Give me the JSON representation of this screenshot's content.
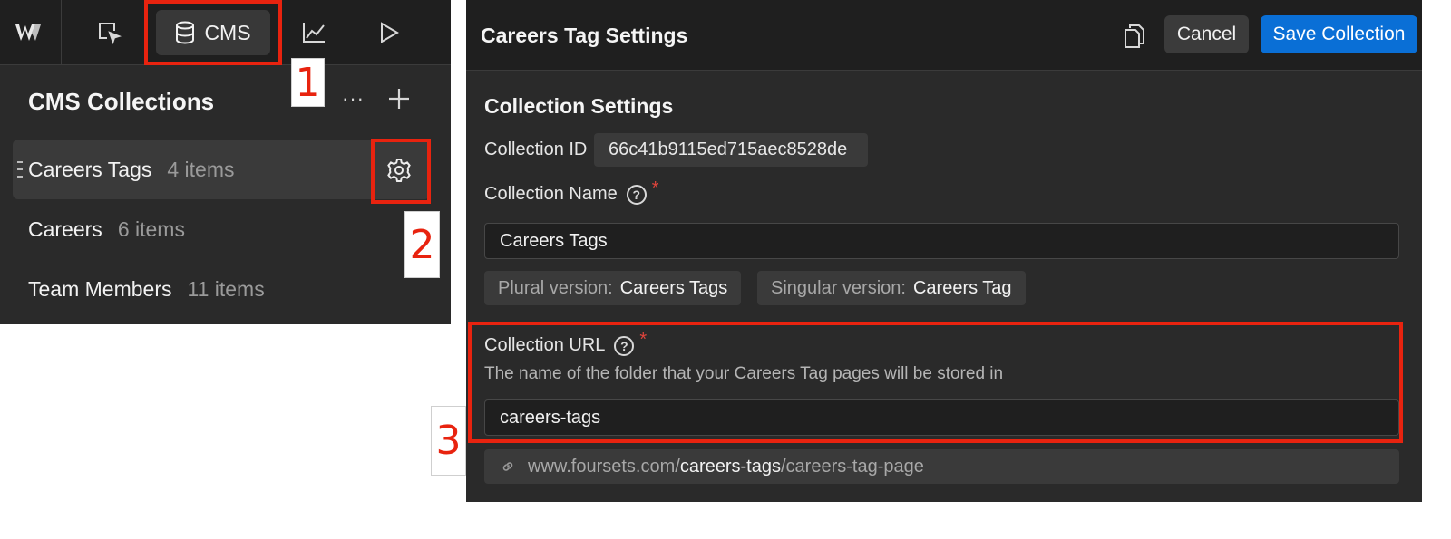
{
  "top_nav": {
    "logo_icon": "webflow-logo-icon",
    "tabs": [
      {
        "icon": "cursor-select-icon",
        "label": ""
      },
      {
        "icon": "database-icon",
        "label": "CMS"
      },
      {
        "icon": "analytics-chart-icon",
        "label": ""
      },
      {
        "icon": "play-icon",
        "label": ""
      }
    ]
  },
  "cms_panel": {
    "title": "CMS Collections",
    "more_label": "···",
    "collections": [
      {
        "name": "Careers Tags",
        "count": "4 items",
        "active": true
      },
      {
        "name": "Careers",
        "count": "6 items",
        "active": false
      },
      {
        "name": "Team Members",
        "count": "11 items",
        "active": false
      }
    ]
  },
  "settings": {
    "title": "Careers Tag Settings",
    "cancel_label": "Cancel",
    "save_label": "Save Collection",
    "section_title": "Collection Settings",
    "collection_id_label": "Collection ID",
    "collection_id": "66c41b9115ed715aec8528de",
    "collection_name_label": "Collection Name",
    "collection_name": "Careers Tags",
    "plural_label": "Plural version:",
    "plural_value": "Careers Tags",
    "singular_label": "Singular version:",
    "singular_value": "Careers Tag",
    "collection_url_label": "Collection URL",
    "collection_url_desc": "The name of the folder that your Careers Tag pages will be stored in",
    "collection_url": "careers-tags",
    "url_preview": {
      "domain": "www.foursets.com/",
      "slug": "careers-tags",
      "page": "/careers-tag-page"
    },
    "required_mark": "*",
    "help_mark": "?"
  },
  "annotations": {
    "step1": "1",
    "step2": "2",
    "step3": "3"
  },
  "colors": {
    "accent": "#0a6fd6",
    "highlight": "#e8230f",
    "panel_bg": "#2a2a2a",
    "header_bg": "#1f1f1f"
  }
}
